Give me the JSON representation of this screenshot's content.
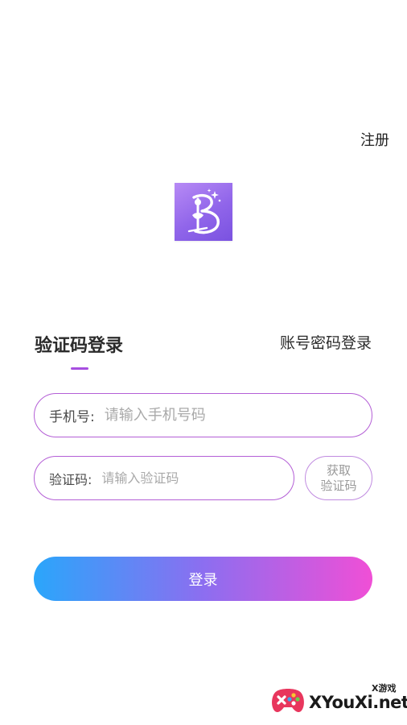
{
  "header": {
    "register_label": "注册"
  },
  "logo": {
    "icon": "app-logo",
    "gradient": [
      "#b78af5",
      "#7a52e0"
    ]
  },
  "tabs": {
    "sms_login_label": "验证码登录",
    "account_login_label": "账号密码登录",
    "active": "sms"
  },
  "form": {
    "phone": {
      "label": "手机号:",
      "placeholder": "请输入手机号码",
      "value": ""
    },
    "code": {
      "label": "验证码:",
      "placeholder": "请输入验证码",
      "value": ""
    },
    "get_code_button": {
      "line1": "获取",
      "line2": "验证码"
    },
    "login_button_label": "登录"
  },
  "colors": {
    "accent": "#a74ee0",
    "border": "#b45fd6",
    "button_gradient": [
      "#2aa6fb",
      "#8c6ef0",
      "#f04fd6"
    ]
  },
  "watermark": {
    "icon": "gamepad-icon",
    "small_text": "X游戏",
    "big_text": "XYouXi.net"
  }
}
